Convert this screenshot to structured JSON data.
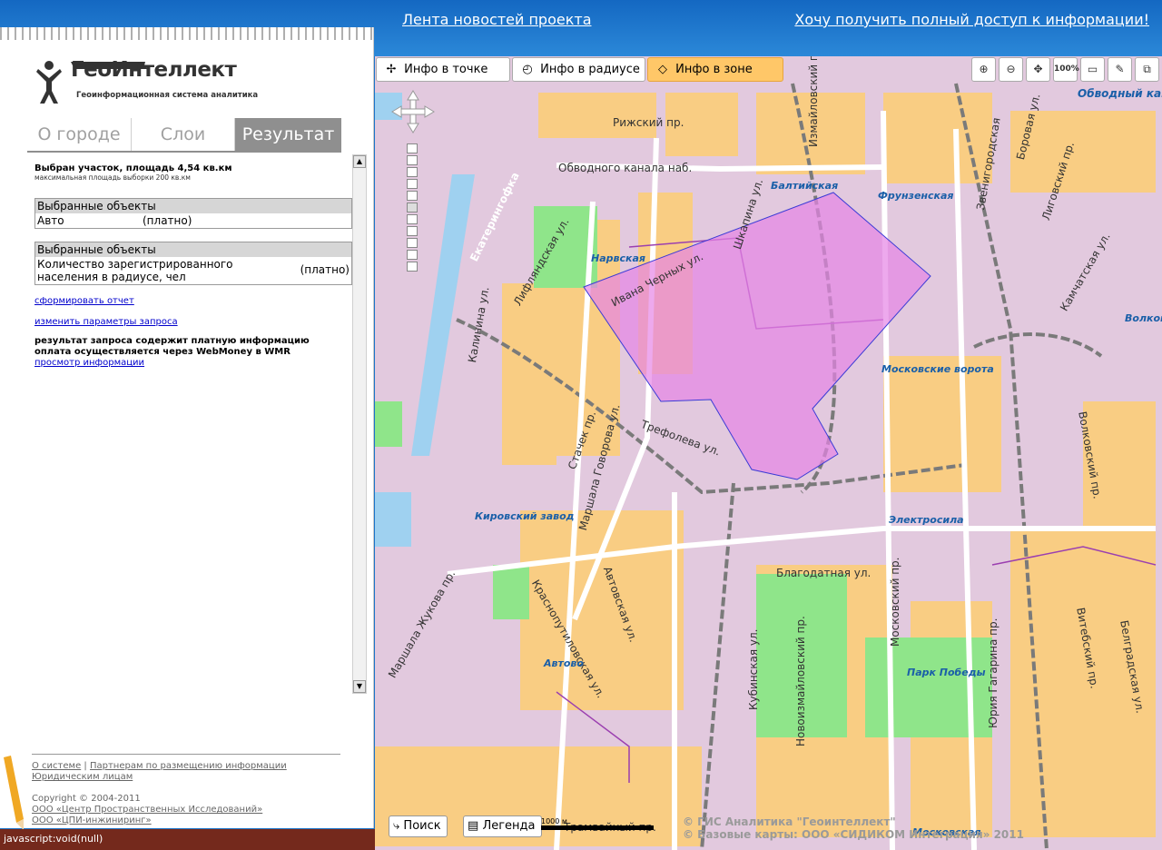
{
  "header": {
    "news_link": "Лента новостей проекта",
    "access_link": "Хочу получить полный доступ к информации!"
  },
  "logo": {
    "title": "ГеоИнтеллект",
    "subtitle": "Геоинформационная система аналитика"
  },
  "tabs": [
    {
      "label": "О городе",
      "active": false
    },
    {
      "label": "Слои",
      "active": false
    },
    {
      "label": "Результат",
      "active": true
    }
  ],
  "result": {
    "selected_area": "Выбран участок, площадь 4,54 кв.км",
    "max_area": "максимальная площадь выборки 200 кв.км",
    "boxes": [
      {
        "header": "Выбранные объекты",
        "item": "Авто",
        "price": "(платно)"
      },
      {
        "header": "Выбранные объекты",
        "item": "Количество зарегистрированного населения в радиусе, чел",
        "price": "(платно)"
      }
    ],
    "report_link": "сформировать отчет",
    "params_link": "изменить параметры запроса",
    "paid_info": "результат запроса содержит платную информацию оплата осуществляется через WebMoney в WMR",
    "view_link": "просмотр информации"
  },
  "footer": {
    "about": "О системе",
    "separator": "|",
    "partners": "Партнерам по размещению информации",
    "legal": "Юридическим лицам",
    "copyright": "Copyright © 2004-2011",
    "org1": "ООО «Центр Пространственных Исследований»",
    "org2": "ООО «ЦПИ-инжиниринг»"
  },
  "status_bar": "javascript:void(null)",
  "toolbar": {
    "info_point": "Инфо в точке",
    "info_radius": "Инфо в радиусе",
    "info_zone": "Инфо в зоне",
    "zoom_100": "100%"
  },
  "map_buttons": {
    "search": "Поиск",
    "legend": "Легенда"
  },
  "scale": "1000 м",
  "copyright": {
    "line1": "© ГИС Аналитика \"Геоинтеллект\"",
    "line2": "© Базовые карты: ООО «СИДИКОМ Интеграция» 2011"
  },
  "map_labels": {
    "streets": [
      "Рижский пр.",
      "Обводного канала наб.",
      "Измайловский пр.",
      "Шкапина ул.",
      "Ивана Черных ул.",
      "Лифляндская ул.",
      "Калинина ул.",
      "Стачек пр.",
      "Маршала Говорова ул.",
      "Трефолева ул.",
      "Краснопутиловская ул.",
      "Автовская ул.",
      "Маршала Жукова пр.",
      "Трамвайный пр.",
      "Благодатная ул.",
      "Кубинская ул.",
      "Новоизмайловский пр.",
      "Московский пр.",
      "Юрия Гагарина пр.",
      "Витебский пр.",
      "Белградская ул.",
      "Волковский пр.",
      "Камчатская ул.",
      "Лиговский пр.",
      "Боровая ул.",
      "Обводный кана",
      "Звенигородская",
      "Екатерингофка"
    ],
    "metro": [
      "Балтийская",
      "Фрунзенская",
      "Нарвская",
      "Московские ворота",
      "Кировский завод",
      "Электросила",
      "Автово",
      "Волков",
      "Парк Победы",
      "Московская"
    ]
  },
  "colors": {
    "header": "#1b74c9",
    "active_tool": "#ffc768",
    "zone": "#e685e6",
    "status": "#74291c"
  }
}
